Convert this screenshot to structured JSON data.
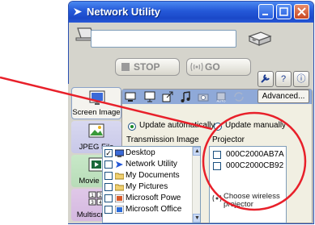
{
  "window": {
    "title": "Network Utility"
  },
  "device": {
    "field_value": ""
  },
  "controls": {
    "stop_label": "STOP",
    "go_label": "GO"
  },
  "help_buttons": [
    "?",
    "ⓘ"
  ],
  "tools": [
    {
      "label": "Screen Image"
    },
    {
      "label": "JPEG File"
    },
    {
      "label": "Movie File"
    },
    {
      "label": "Multiscreen"
    }
  ],
  "panel": {
    "advanced_label": "Advanced...",
    "update_auto": "Update automatically",
    "update_manual": "Update manually",
    "transmission_header": "Transmission Image",
    "projector_header": "Projector",
    "transmission_items": [
      {
        "label": "Desktop",
        "checked": true
      },
      {
        "label": "Network Utility",
        "checked": false
      },
      {
        "label": "My Documents",
        "checked": false
      },
      {
        "label": "My Pictures",
        "checked": false
      },
      {
        "label": "Microsoft Powe",
        "checked": false
      },
      {
        "label": "Microsoft Office",
        "checked": false
      }
    ],
    "projectors": [
      {
        "label": "000C2000AB7A",
        "checked": false
      },
      {
        "label": "000C2000CB92",
        "checked": false
      }
    ],
    "choose_label": "Choose wireless projector"
  },
  "colors": {
    "title_bar": "#2458d8",
    "callout": "#e8202a",
    "toolbar_strip": "#8fa9d8"
  }
}
